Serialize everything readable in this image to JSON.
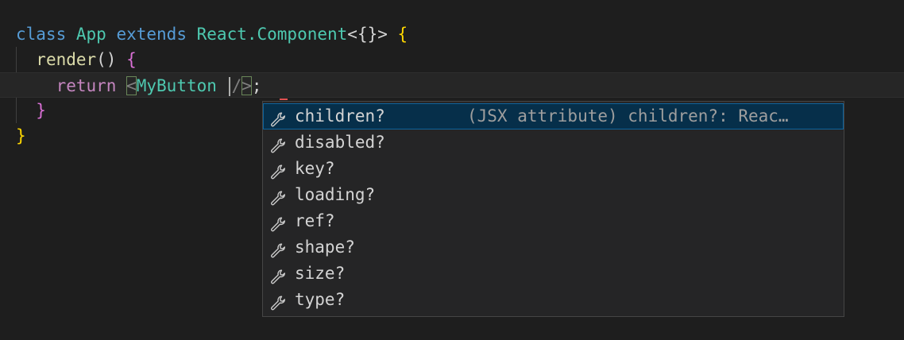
{
  "code": {
    "line1": {
      "kw_class": "class",
      "class_name": "App",
      "kw_extends": "extends",
      "base": "React.Component",
      "generic": "<{}>",
      "brace": "{"
    },
    "line2": {
      "method": "render",
      "parens": "()",
      "brace": "{"
    },
    "line3": {
      "kw_return": "return",
      "lt": "<",
      "tag": "MyButton",
      "slash": "/",
      "gt": ">",
      "semi": ";"
    },
    "line4": {
      "brace": "}"
    },
    "line5": {
      "brace": "}"
    }
  },
  "suggest": {
    "selected_index": 0,
    "items": [
      {
        "label": "children?",
        "detail": "(JSX attribute) children?: Reac…",
        "icon": "wrench-icon"
      },
      {
        "label": "disabled?",
        "detail": "",
        "icon": "wrench-icon"
      },
      {
        "label": "key?",
        "detail": "",
        "icon": "wrench-icon"
      },
      {
        "label": "loading?",
        "detail": "",
        "icon": "wrench-icon"
      },
      {
        "label": "ref?",
        "detail": "",
        "icon": "wrench-icon"
      },
      {
        "label": "shape?",
        "detail": "",
        "icon": "wrench-icon"
      },
      {
        "label": "size?",
        "detail": "",
        "icon": "wrench-icon"
      },
      {
        "label": "type?",
        "detail": "",
        "icon": "wrench-icon"
      }
    ]
  },
  "colors": {
    "background": "#1e1e1e",
    "keyword": "#569cd6",
    "type": "#4ec9b0",
    "function": "#dcdcaa",
    "control": "#c586c0",
    "selection": "#062f4a"
  }
}
